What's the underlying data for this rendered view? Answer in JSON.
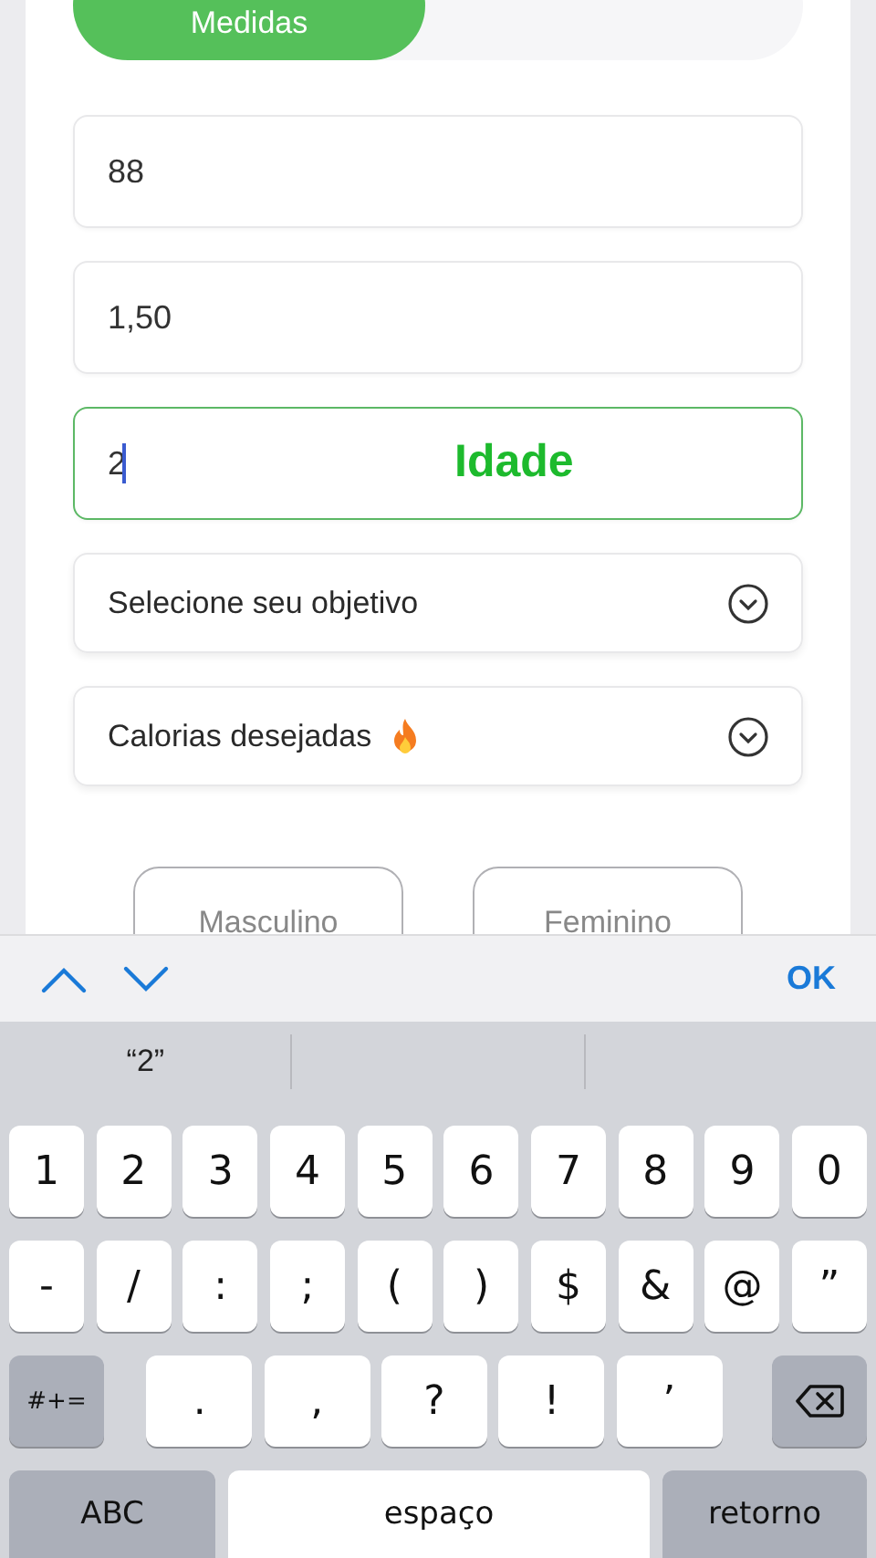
{
  "tabs": [
    {
      "label": "Medidas",
      "selected": true
    }
  ],
  "fields": [
    {
      "kind": "input",
      "value": "88",
      "focused": false
    },
    {
      "kind": "input",
      "value": "1,50",
      "focused": false
    },
    {
      "kind": "input",
      "value": "2",
      "focused": true,
      "label": "Idade"
    },
    {
      "kind": "select",
      "placeholder": "Selecione seu objetivo"
    },
    {
      "kind": "select_flame",
      "placeholder": "Calorias desejadas"
    }
  ],
  "gender_buttons": [
    {
      "label": "Masculino",
      "selected": false
    },
    {
      "label": "Feminino",
      "selected": false
    }
  ],
  "keyboard_toolbar": {
    "done": "OK"
  },
  "suggestions": [
    "“2”"
  ],
  "keyboard_rows": [
    [
      {
        "kind": "char",
        "label": "1"
      },
      {
        "kind": "char",
        "label": "2"
      },
      {
        "kind": "char",
        "label": "3"
      },
      {
        "kind": "char",
        "label": "4"
      },
      {
        "kind": "char",
        "label": "5"
      },
      {
        "kind": "char",
        "label": "6"
      },
      {
        "kind": "char",
        "label": "7"
      },
      {
        "kind": "char",
        "label": "8"
      },
      {
        "kind": "char",
        "label": "9"
      },
      {
        "kind": "char",
        "label": "0"
      }
    ],
    [
      {
        "kind": "char",
        "label": "-"
      },
      {
        "kind": "char",
        "label": "/"
      },
      {
        "kind": "char",
        "label": ":"
      },
      {
        "kind": "char",
        "label": ";"
      },
      {
        "kind": "char",
        "label": "("
      },
      {
        "kind": "char",
        "label": ")"
      },
      {
        "kind": "char",
        "label": "$"
      },
      {
        "kind": "char",
        "label": "&"
      },
      {
        "kind": "char",
        "label": "@"
      },
      {
        "kind": "char",
        "label": "”"
      }
    ],
    [
      {
        "kind": "mode",
        "label": "#+="
      },
      {
        "kind": "wide",
        "label": "."
      },
      {
        "kind": "wide",
        "label": ","
      },
      {
        "kind": "wide",
        "label": "?"
      },
      {
        "kind": "wide",
        "label": "!"
      },
      {
        "kind": "wide",
        "label": "’"
      },
      {
        "kind": "delete"
      }
    ],
    [
      {
        "kind": "abc",
        "label": "ABC"
      },
      {
        "kind": "space",
        "label": "espaço"
      },
      {
        "kind": "return",
        "label": "retorno"
      }
    ]
  ]
}
